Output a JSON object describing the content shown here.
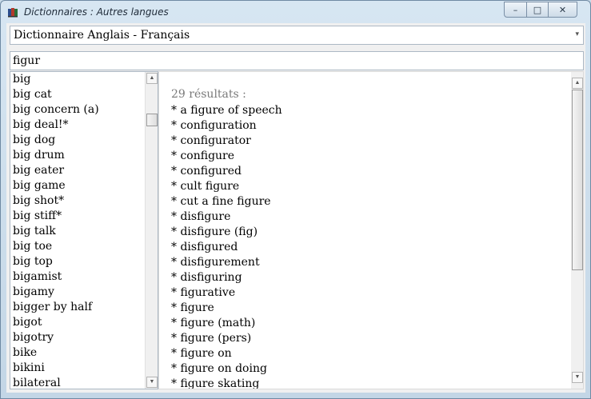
{
  "window": {
    "title": "Dictionnaires : Autres langues",
    "minimize_glyph": "–",
    "maximize_glyph": "□",
    "close_glyph": "✕"
  },
  "dictionary": {
    "selected": "Dictionnaire Anglais - Français",
    "arrow_glyph": "▾"
  },
  "search": {
    "value": "figur"
  },
  "word_list": [
    "big",
    "big cat",
    "big concern (a)",
    "big deal!*",
    "big dog",
    "big drum",
    "big eater",
    "big game",
    "big shot*",
    "big stiff*",
    "big talk",
    "big toe",
    "big top",
    "bigamist",
    "bigamy",
    "bigger by half",
    "bigot",
    "bigotry",
    "bike",
    "bikini",
    "bilateral"
  ],
  "results": {
    "count_label": "29 résultats :",
    "items": [
      "* a figure of speech",
      "* configuration",
      "* configurator",
      "* configure",
      "* configured",
      "* cult figure",
      "* cut a fine figure",
      "* disfigure",
      "* disfigure (fig)",
      "* disfigured",
      "* disfigurement",
      "* disfiguring",
      "* figurative",
      "* figure",
      "* figure (math)",
      "* figure (pers)",
      "* figure on",
      "* figure on doing",
      "* figure skating"
    ]
  },
  "scrollbar": {
    "up_glyph": "▲",
    "down_glyph": "▼"
  },
  "icons": {
    "app": "dictionary-book-icon"
  },
  "colors": {
    "window_frame": "#c9dbe9",
    "result_count": "#7a7a7a"
  }
}
